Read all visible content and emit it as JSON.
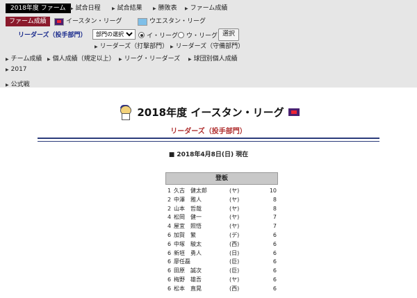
{
  "nav": {
    "year_tab": "2018年度 ファーム",
    "links": [
      "試合日程",
      "試合結果",
      "勝敗表",
      "ファーム成績"
    ],
    "farm_stats_tab": "ファーム成績",
    "eastern_league": "イースタン・リーグ",
    "western_league": "ウエスタン・リーグ",
    "leaders_label": "リーダーズ（投手部門）",
    "select_value": "部門の選択",
    "radio_i": "イ・リーグ",
    "radio_u": "ウ・リーグ",
    "select_button": "選択",
    "sub_batting": "リーダーズ（打撃部門）",
    "sub_fielding": "リーダーズ（守備部門）",
    "row3": [
      "チーム成績",
      "個人成績（規定以上）",
      "リーグ・リーダーズ",
      "球団別個人成績"
    ],
    "row4": "2017",
    "row5": "公式戦"
  },
  "content": {
    "title": "2018年度 イースタン・リーグ",
    "subtitle": "リーダーズ（投手部門）",
    "date": "2018年4月8日(日) 現在",
    "table_header": "登板",
    "rows": [
      {
        "rank": "1",
        "name": "久古　健太郎",
        "team": "(ヤ)",
        "value": "10"
      },
      {
        "rank": "2",
        "name": "中澤　雅人",
        "team": "(ヤ)",
        "value": "8"
      },
      {
        "rank": "2",
        "name": "山本　哲哉",
        "team": "(ヤ)",
        "value": "8"
      },
      {
        "rank": "4",
        "name": "松岡　健一",
        "team": "(ヤ)",
        "value": "7"
      },
      {
        "rank": "4",
        "name": "屋宜　照悟",
        "team": "(ヤ)",
        "value": "7"
      },
      {
        "rank": "6",
        "name": "加賀　繁",
        "team": "(デ)",
        "value": "6"
      },
      {
        "rank": "6",
        "name": "中塚　駿太",
        "team": "(西)",
        "value": "6"
      },
      {
        "rank": "6",
        "name": "新垣　勇人",
        "team": "(日)",
        "value": "6"
      },
      {
        "rank": "6",
        "name": "廖任磊",
        "team": "(巨)",
        "value": "6"
      },
      {
        "rank": "6",
        "name": "田原　誠次",
        "team": "(巨)",
        "value": "6"
      },
      {
        "rank": "6",
        "name": "梅野　雄吾",
        "team": "(ヤ)",
        "value": "6"
      },
      {
        "rank": "6",
        "name": "松本　直晃",
        "team": "(西)",
        "value": "6"
      }
    ]
  },
  "colors": {
    "nav_bg": "#e6e6e6",
    "farm_tab": "#8b1a2c",
    "leaders_blue": "#1a2b8c",
    "subtitle_red": "#b03030",
    "rule": "#2a3a7a"
  }
}
